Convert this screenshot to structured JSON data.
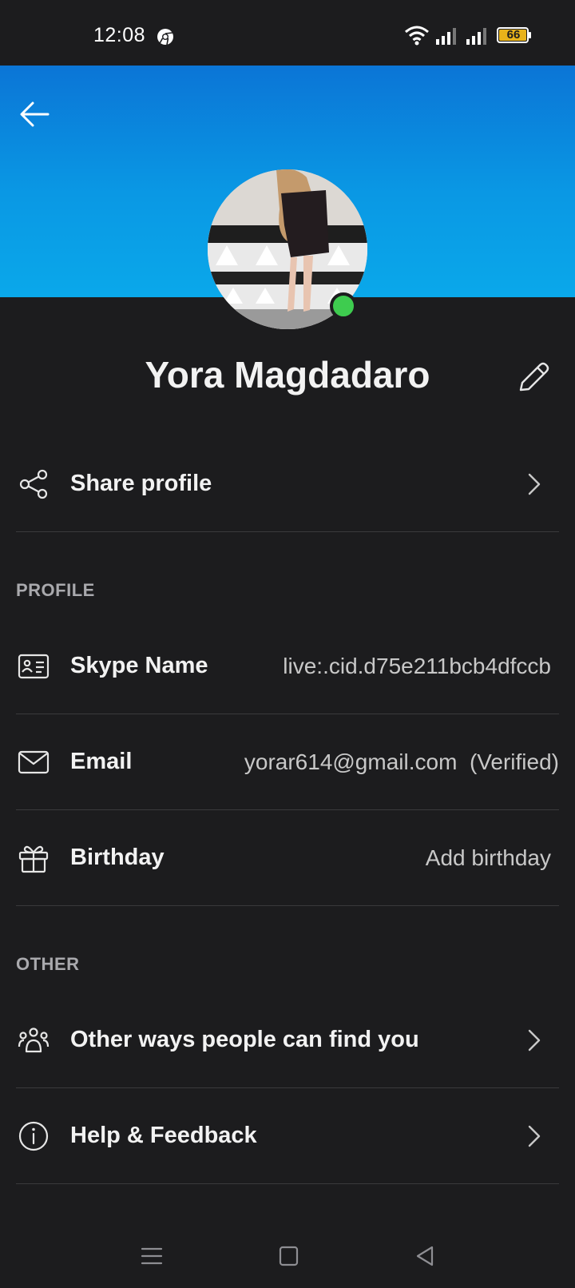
{
  "status_bar": {
    "time": "12:08",
    "battery": "66",
    "icons": [
      "chrome-icon",
      "wifi-icon",
      "signal-icon",
      "signal-icon",
      "battery-icon"
    ]
  },
  "header": {
    "back_icon": "arrow-left-icon",
    "accent_gradient": [
      "#0b75d6",
      "#0aa8ea"
    ],
    "presence_color": "#3ecc4f"
  },
  "profile": {
    "name": "Yora Magdadaro",
    "edit_icon": "pencil-icon"
  },
  "share": {
    "label": "Share profile",
    "icon": "share-icon"
  },
  "profile_section": {
    "title": "PROFILE",
    "rows": [
      {
        "label": "Skype Name",
        "value": "live:.cid.d75e211bcb4dfccb",
        "icon": "id-card-icon"
      },
      {
        "label": "Email",
        "value": "yorar614@gmail.com  (Verified)",
        "icon": "mail-icon"
      },
      {
        "label": "Birthday",
        "value": "Add birthday",
        "icon": "gift-icon"
      }
    ]
  },
  "other_section": {
    "title": "OTHER",
    "rows": [
      {
        "label": "Other ways people can find you",
        "icon": "people-icon"
      },
      {
        "label": "Help & Feedback",
        "icon": "info-icon"
      }
    ]
  },
  "nav_bar": {
    "icons": [
      "menu-icon",
      "home-square-icon",
      "back-triangle-icon"
    ]
  }
}
